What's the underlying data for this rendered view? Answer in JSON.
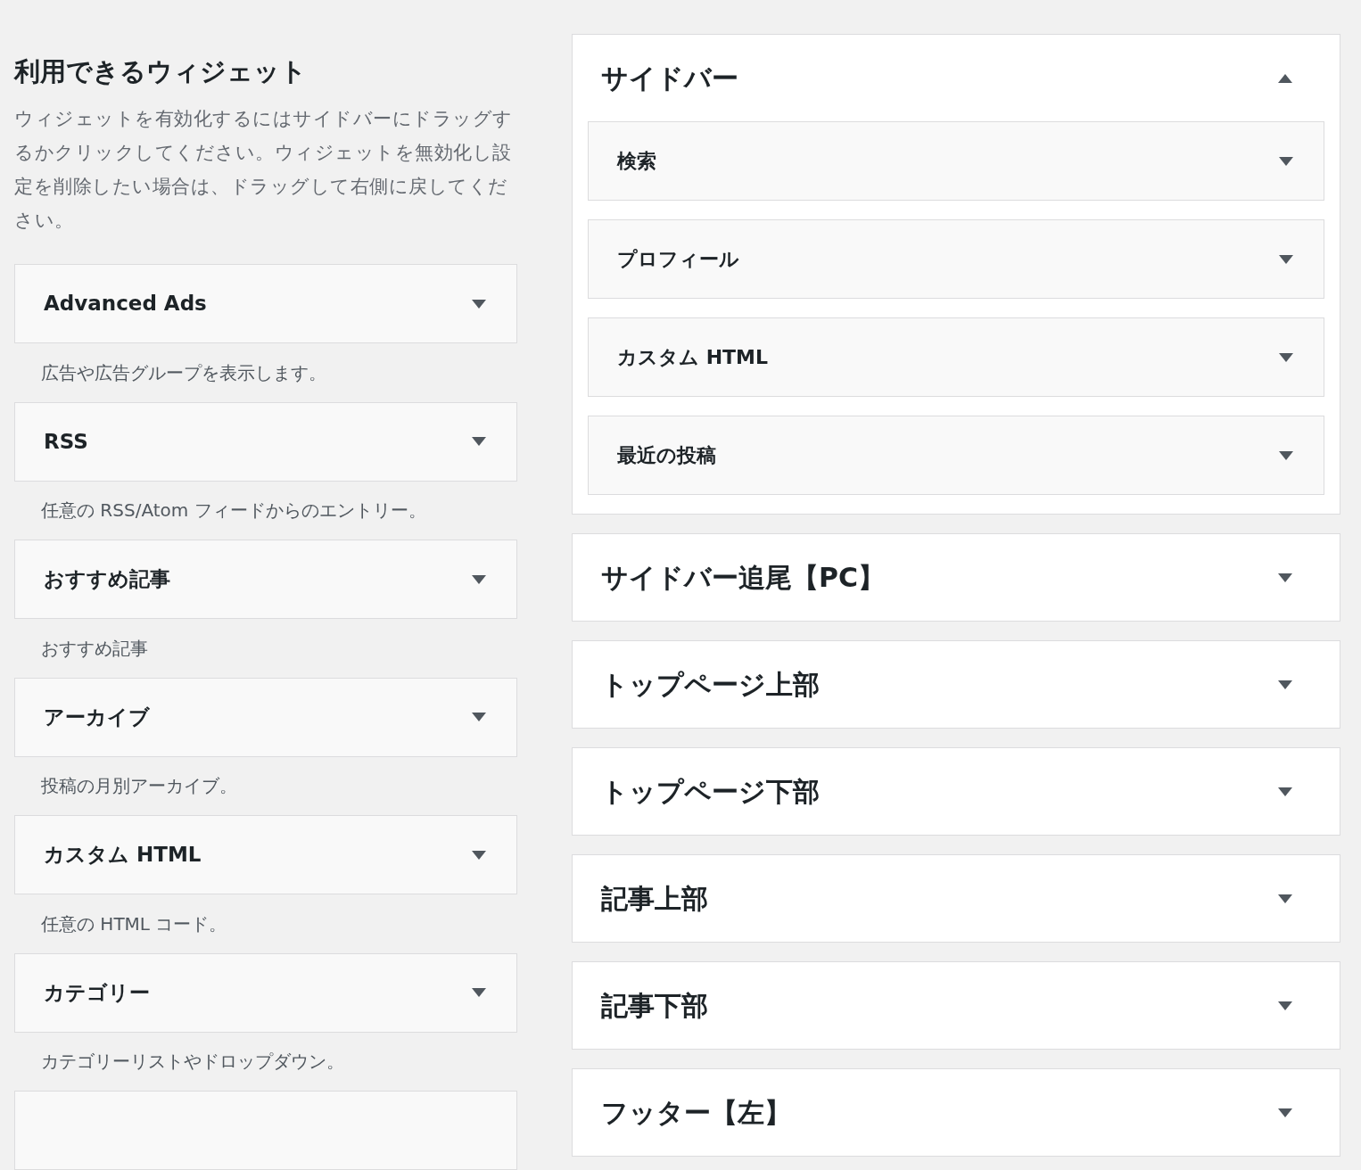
{
  "available": {
    "title": "利用できるウィジェット",
    "description": "ウィジェットを有効化するにはサイドバーにドラッグするかクリックしてください。ウィジェットを無効化し設定を削除したい場合は、ドラッグして右側に戻してください。",
    "widgets": [
      {
        "name": "Advanced Ads",
        "description": "広告や広告グループを表示します。"
      },
      {
        "name": "RSS",
        "description": "任意の RSS/Atom フィードからのエントリー。"
      },
      {
        "name": "おすすめ記事",
        "description": "おすすめ記事"
      },
      {
        "name": "アーカイブ",
        "description": "投稿の月別アーカイブ。"
      },
      {
        "name": "カスタム HTML",
        "description": "任意の HTML コード。"
      },
      {
        "name": "カテゴリー",
        "description": "カテゴリーリストやドロップダウン。"
      }
    ]
  },
  "sidebars": [
    {
      "title": "サイドバー",
      "expanded": true,
      "widgets": [
        "検索",
        "プロフィール",
        "カスタム HTML",
        "最近の投稿"
      ]
    },
    {
      "title": "サイドバー追尾【PC】",
      "expanded": false
    },
    {
      "title": "トップページ上部",
      "expanded": false
    },
    {
      "title": "トップページ下部",
      "expanded": false
    },
    {
      "title": "記事上部",
      "expanded": false
    },
    {
      "title": "記事下部",
      "expanded": false
    },
    {
      "title": "フッター【左】",
      "expanded": false
    }
  ]
}
